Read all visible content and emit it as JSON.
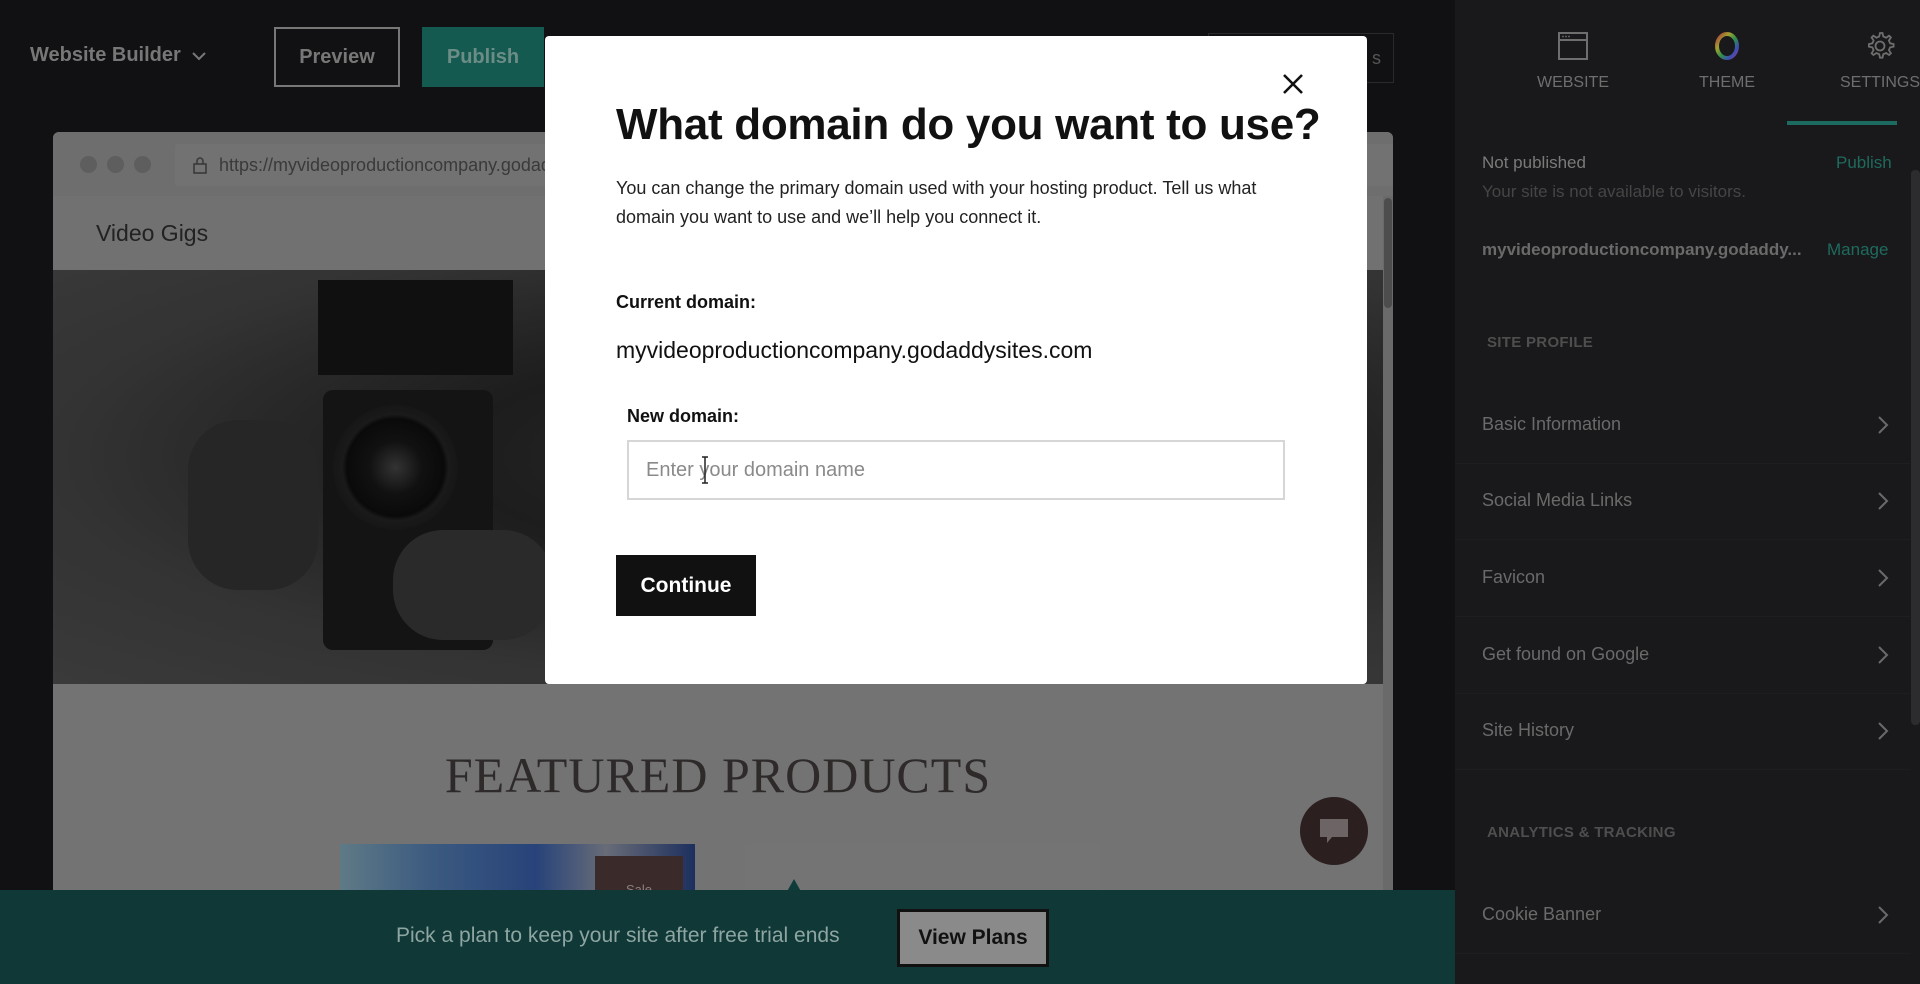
{
  "topbar": {
    "brand_label": "Website Builder",
    "preview_label": "Preview",
    "publish_label": "Publish",
    "ghost_button_label_fragment": "s"
  },
  "preview": {
    "url": "https://myvideoproductioncompany.godaddysites.com",
    "site_title": "Video Gigs",
    "featured_title": "FEATURED PRODUCTS",
    "sale_badge": "Sale"
  },
  "banner": {
    "text": "Pick a plan to keep your site after free trial ends",
    "button_label": "View Plans"
  },
  "panel": {
    "tabs": [
      {
        "label": "WEBSITE",
        "icon": "browser-window-icon",
        "active": false
      },
      {
        "label": "THEME",
        "icon": "color-ring-icon",
        "active": false
      },
      {
        "label": "SETTINGS",
        "icon": "gear-icon",
        "active": true
      }
    ],
    "status": {
      "label": "Not published",
      "action": "Publish",
      "subtext": "Your site is not available to visitors."
    },
    "domain": {
      "name": "myvideoproductioncompany.godaddy...",
      "action": "Manage"
    },
    "sections": [
      {
        "heading": "SITE PROFILE",
        "items": [
          "Basic Information",
          "Social Media Links",
          "Favicon",
          "Get found on Google",
          "Site History"
        ]
      },
      {
        "heading": "ANALYTICS & TRACKING",
        "items": [
          "Cookie Banner"
        ]
      }
    ]
  },
  "modal": {
    "title": "What domain do you want to use?",
    "description": "You can change the primary domain used with your hosting product. Tell us what domain you want to use and we’ll help you connect it.",
    "current_label": "Current domain:",
    "current_value": "myvideoproductioncompany.godaddysites.com",
    "new_label": "New domain:",
    "new_value": "",
    "new_placeholder": "Enter your domain name",
    "continue_label": "Continue"
  },
  "colors": {
    "accent_green": "#1d6b60",
    "banner_bg": "#0f3836",
    "panel_bg": "#19191b",
    "modal_bg": "#ffffff"
  }
}
